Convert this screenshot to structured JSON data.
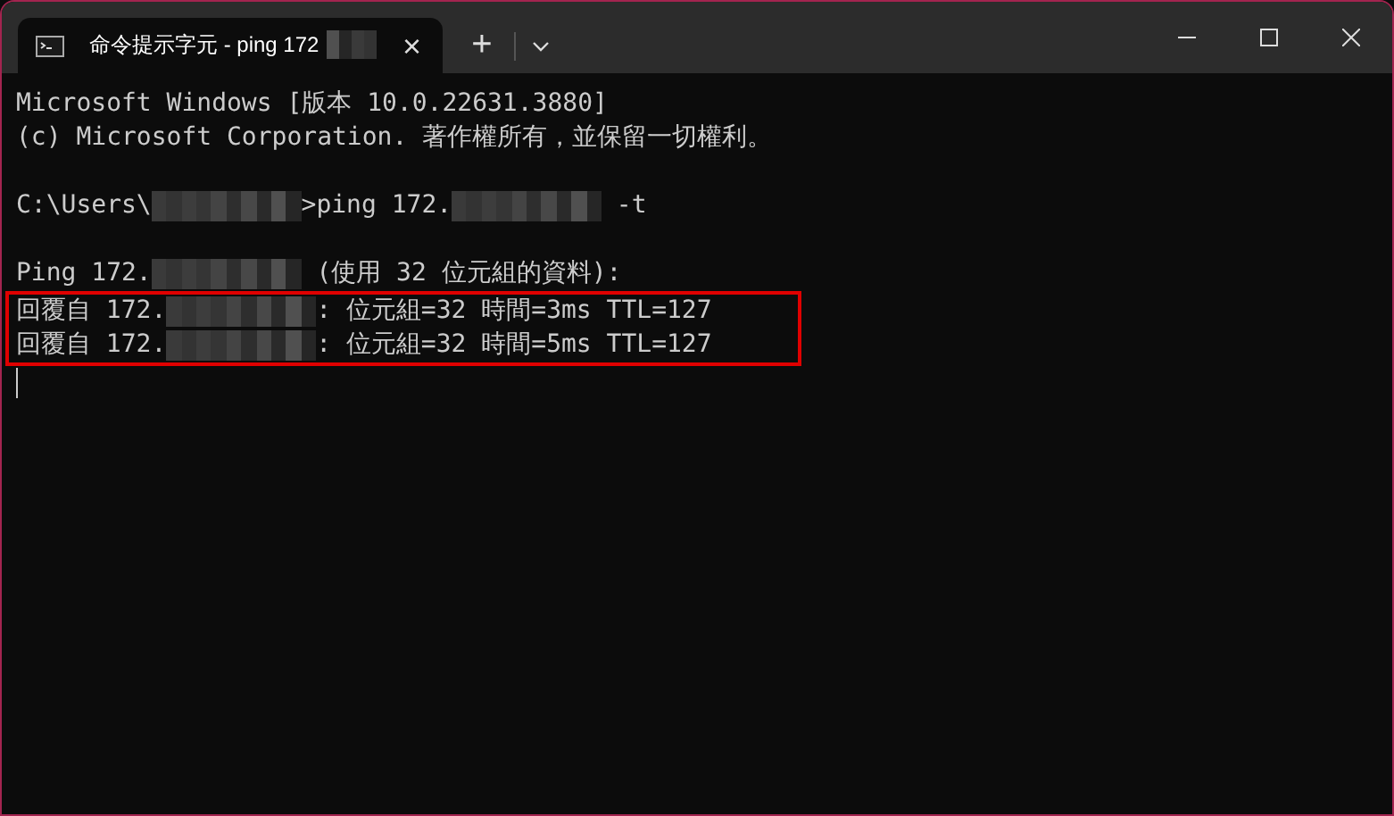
{
  "tab": {
    "title": "命令提示字元 - ping 172",
    "title_redacted": true,
    "close": "×",
    "selected": true
  },
  "new_tab": "+",
  "lines": [
    {
      "kind": "text",
      "highlighted": false,
      "segments": [
        {
          "kind": "text",
          "text": "Microsoft Windows [版本 10.0.22631.3880]"
        }
      ]
    },
    {
      "kind": "text",
      "highlighted": false,
      "segments": [
        {
          "kind": "text",
          "text": "(c) Microsoft Corporation. 著作權所有，並保留一切權利。"
        }
      ]
    },
    {
      "kind": "blank",
      "highlighted": false
    },
    {
      "kind": "text",
      "highlighted": false,
      "segments": [
        {
          "kind": "text",
          "text": "C:\\Users\\"
        },
        {
          "kind": "redacted"
        },
        {
          "kind": "text",
          "text": ">ping 172."
        },
        {
          "kind": "redacted"
        },
        {
          "kind": "text",
          "text": " -t"
        }
      ]
    },
    {
      "kind": "blank",
      "highlighted": false
    },
    {
      "kind": "text",
      "highlighted": false,
      "segments": [
        {
          "kind": "text",
          "text": "Ping 172."
        },
        {
          "kind": "redacted"
        },
        {
          "kind": "text",
          "text": " (使用 32 位元組的資料):"
        }
      ]
    },
    {
      "kind": "text",
      "highlighted": true,
      "segments": [
        {
          "kind": "text",
          "text": "回覆自 172."
        },
        {
          "kind": "redacted"
        },
        {
          "kind": "text",
          "text": ": 位元組=32 時間=3ms TTL=127"
        }
      ]
    },
    {
      "kind": "text",
      "highlighted": true,
      "segments": [
        {
          "kind": "text",
          "text": "回覆自 172."
        },
        {
          "kind": "redacted"
        },
        {
          "kind": "text",
          "text": ": 位元組=32 時間=5ms TTL=127"
        }
      ]
    },
    {
      "kind": "cursor",
      "highlighted": false
    }
  ]
}
